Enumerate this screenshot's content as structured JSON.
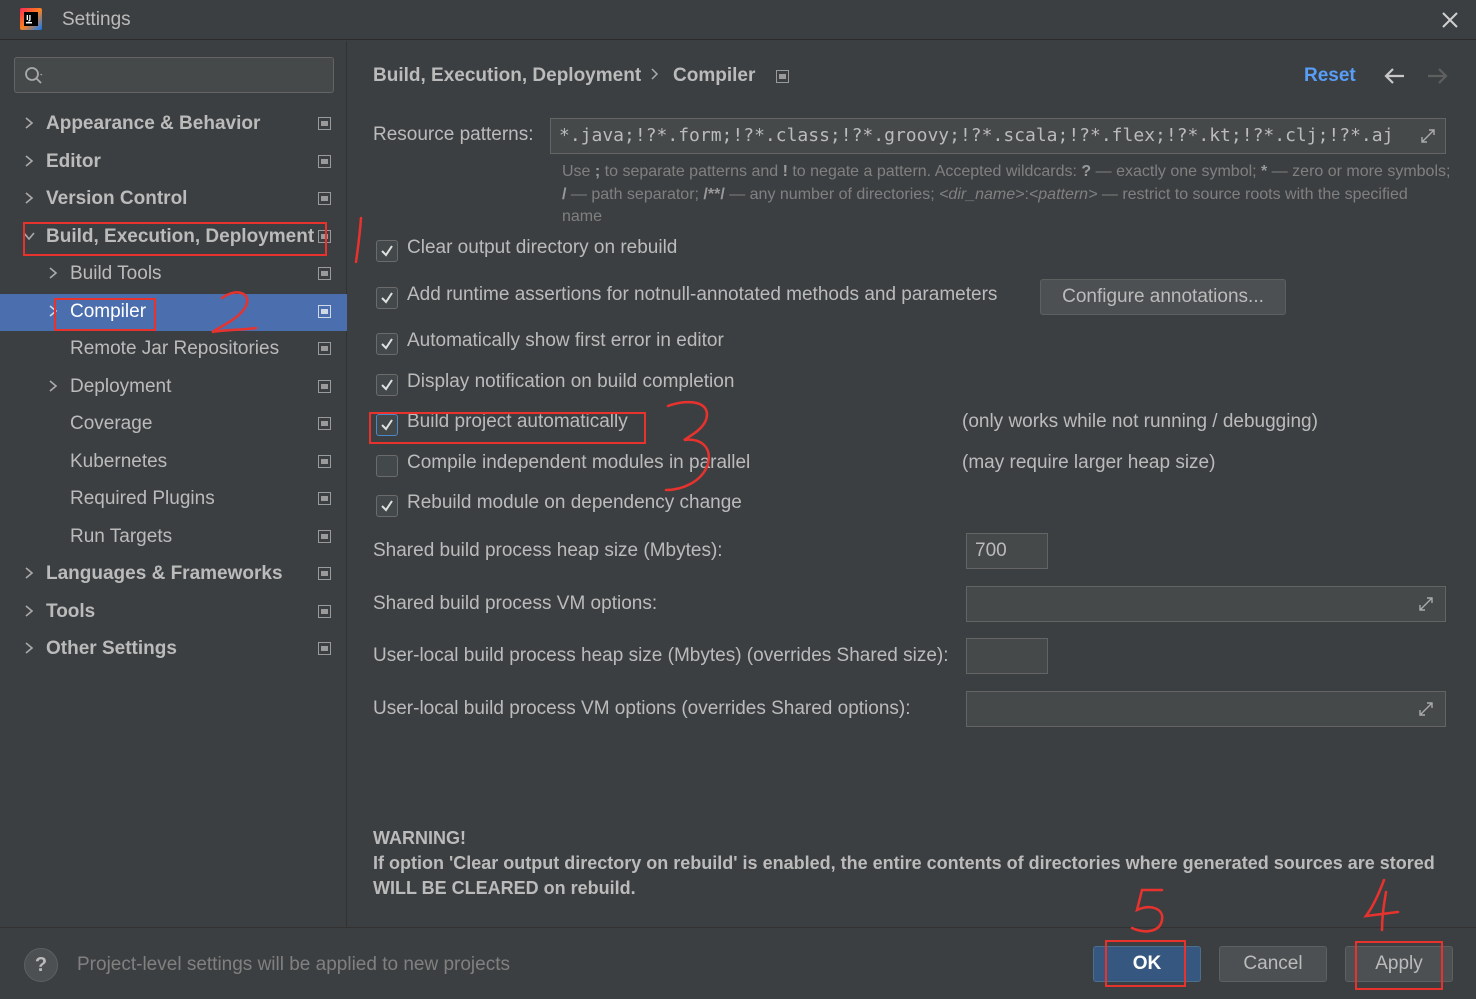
{
  "window": {
    "title": "Settings"
  },
  "search": {
    "placeholder": "",
    "value": ""
  },
  "sidebar": {
    "items": [
      {
        "label": "Appearance & Behavior"
      },
      {
        "label": "Editor"
      },
      {
        "label": "Version Control"
      },
      {
        "label": "Build, Execution, Deployment"
      },
      {
        "label": "Build Tools"
      },
      {
        "label": "Compiler"
      },
      {
        "label": "Remote Jar Repositories"
      },
      {
        "label": "Deployment"
      },
      {
        "label": "Coverage"
      },
      {
        "label": "Kubernetes"
      },
      {
        "label": "Required Plugins"
      },
      {
        "label": "Run Targets"
      },
      {
        "label": "Languages & Frameworks"
      },
      {
        "label": "Tools"
      },
      {
        "label": "Other Settings"
      }
    ]
  },
  "header": {
    "breadcrumb_parent": "Build, Execution, Deployment",
    "breadcrumb_current": "Compiler",
    "reset_label": "Reset"
  },
  "compiler": {
    "resource_patterns_label": "Resource patterns:",
    "resource_patterns_value": "*.java;!?*.form;!?*.class;!?*.groovy;!?*.scala;!?*.flex;!?*.kt;!?*.clj;!?*.aj",
    "hint": {
      "p1": "Use ",
      "b1": ";",
      "p2": " to separate patterns and ",
      "b2": "!",
      "p3": " to negate a pattern. Accepted wildcards: ",
      "b3": "?",
      "p4": " — exactly one symbol; ",
      "b4": "*",
      "p5": " — zero or more symbols; ",
      "b5": "/",
      "p6": " — path separator; ",
      "b6": "/**/",
      "p7": " — any number of directories; ",
      "i1": "<dir_name>",
      "p8": ":",
      "i2": "<pattern>",
      "p9": " — restrict to source roots with the specified name"
    },
    "options": [
      {
        "label": "Clear output directory on rebuild",
        "checked": true
      },
      {
        "label": "Add runtime assertions for notnull-annotated methods and parameters",
        "checked": true
      },
      {
        "label": "Automatically show first error in editor",
        "checked": true
      },
      {
        "label": "Display notification on build completion",
        "checked": true
      },
      {
        "label": "Build project automatically",
        "checked": true
      },
      {
        "label": "Compile independent modules in parallel",
        "checked": false
      },
      {
        "label": "Rebuild module on dependency change",
        "checked": true
      }
    ],
    "configure_annotations_label": "Configure annotations...",
    "build_auto_note": "(only works while not running / debugging)",
    "parallel_note": "(may require larger heap size)",
    "shared_heap_label": "Shared build process heap size (Mbytes):",
    "shared_heap_value": "700",
    "shared_vm_label": "Shared build process VM options:",
    "shared_vm_value": "",
    "user_heap_label": "User-local build process heap size (Mbytes) (overrides Shared size):",
    "user_heap_value": "",
    "user_vm_label": "User-local build process VM options (overrides Shared options):",
    "user_vm_value": "",
    "warning_title": "WARNING!",
    "warning_text": "If option 'Clear output directory on rebuild' is enabled, the entire contents of directories where generated sources are stored WILL BE CLEARED on rebuild."
  },
  "footer": {
    "help": "?",
    "note": "Project-level settings will be applied to new projects",
    "ok_label": "OK",
    "cancel_label": "Cancel",
    "apply_label": "Apply"
  },
  "annotations": {
    "marks": [
      "1",
      "2",
      "3",
      "4",
      "5"
    ],
    "color": "#e8322e"
  },
  "colors": {
    "background": "#3c3f41",
    "selection": "#4b6eaf",
    "link": "#589df6",
    "primary_button": "#365880"
  }
}
